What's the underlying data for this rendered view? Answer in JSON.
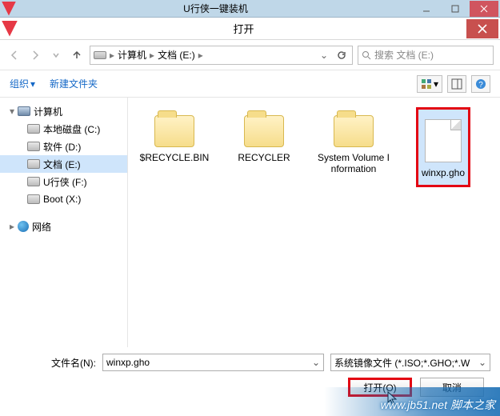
{
  "outerWindow": {
    "title": "U行侠一键装机"
  },
  "dialog": {
    "title": "打开"
  },
  "breadcrumb": {
    "root": "计算机",
    "drive": "文档 (E:)"
  },
  "search": {
    "placeholder": "搜索 文档 (E:)"
  },
  "toolbar": {
    "organize": "组织",
    "newFolder": "新建文件夹"
  },
  "sidebar": {
    "computer": "计算机",
    "drives": [
      "本地磁盘 (C:)",
      "软件 (D:)",
      "文档 (E:)",
      "U行侠 (F:)",
      "Boot (X:)"
    ],
    "selectedIndex": 2,
    "network": "网络"
  },
  "files": {
    "items": [
      {
        "name": "$RECYCLE.BIN",
        "type": "folder"
      },
      {
        "name": "RECYCLER",
        "type": "folder"
      },
      {
        "name": "System Volume Information",
        "type": "folder"
      },
      {
        "name": "winxp.gho",
        "type": "file",
        "selected": true
      }
    ]
  },
  "footer": {
    "filenameLabel": "文件名(N):",
    "filenameValue": "winxp.gho",
    "filterValue": "系统镜像文件 (*.ISO;*.GHO;*.W",
    "openLabel": "打开(O)",
    "cancelLabel": "取消"
  },
  "watermark": {
    "site": "www.jb51.net",
    "name": "脚本之家"
  }
}
